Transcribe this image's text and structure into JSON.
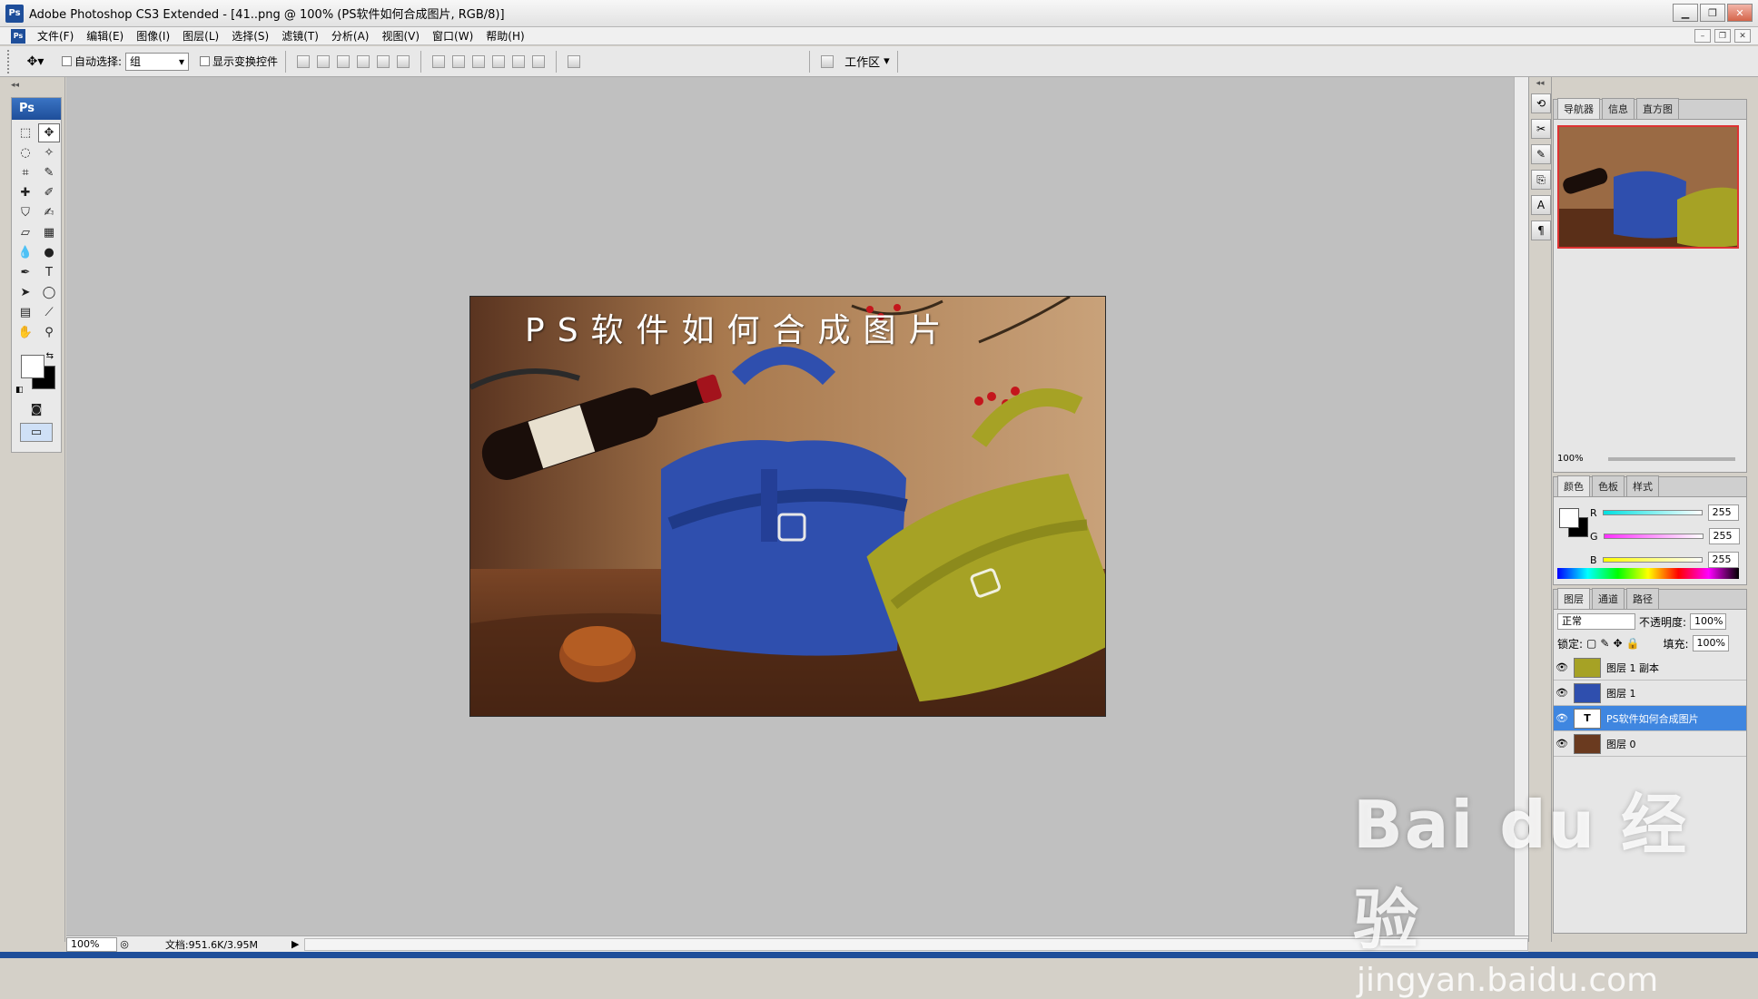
{
  "app": {
    "title": "Adobe Photoshop CS3 Extended - [41..png @ 100% (PS软件如何合成图片, RGB/8)]",
    "badge": "Ps"
  },
  "menu": [
    "文件(F)",
    "编辑(E)",
    "图像(I)",
    "图层(L)",
    "选择(S)",
    "滤镜(T)",
    "分析(A)",
    "视图(V)",
    "窗口(W)",
    "帮助(H)"
  ],
  "options": {
    "auto_select_label": "自动选择:",
    "auto_select_value": "组",
    "show_transform_label": "显示变换控件",
    "workspace_label": "工作区"
  },
  "toolbox": {
    "badge": "Ps"
  },
  "image": {
    "caption": "PS软件如何合成图片",
    "colors": {
      "bag_blue": "#2f4fae",
      "bag_yellow": "#a6a225",
      "wood": "#6a3a1f",
      "wall": "#a8794e"
    }
  },
  "status": {
    "zoom": "100%",
    "doc": "文档:951.6K/3.95M"
  },
  "navigator": {
    "tabs": [
      "导航器",
      "信息",
      "直方图"
    ],
    "zoom": "100%"
  },
  "color_panel": {
    "tabs": [
      "颜色",
      "色板",
      "样式"
    ],
    "channels": [
      {
        "label": "R",
        "value": "255",
        "color": "#00e0e0"
      },
      {
        "label": "G",
        "value": "255",
        "color": "#ff30ff"
      },
      {
        "label": "B",
        "value": "255",
        "color": "#ffff00"
      }
    ]
  },
  "layers_panel": {
    "tabs": [
      "图层",
      "通道",
      "路径"
    ],
    "blend_mode": "正常",
    "opacity_label": "不透明度:",
    "opacity": "100%",
    "lock_label": "锁定:",
    "fill_label": "填充:",
    "fill": "100%",
    "layers": [
      {
        "name": "图层 1 副本",
        "selected": false,
        "type": "image"
      },
      {
        "name": "图层 1",
        "selected": false,
        "type": "image"
      },
      {
        "name": "PS软件如何合成图片",
        "selected": true,
        "type": "text"
      },
      {
        "name": "图层 0",
        "selected": false,
        "type": "image"
      }
    ]
  },
  "watermark": {
    "brand": "Bai du 经验",
    "url": "jingyan.baidu.com"
  }
}
